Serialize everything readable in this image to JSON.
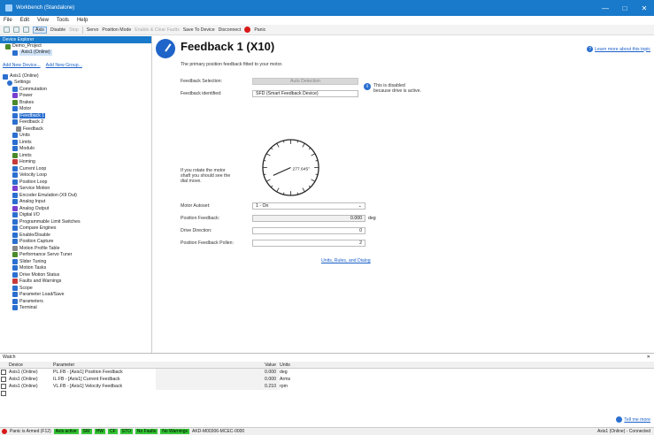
{
  "window": {
    "title": "Workbench (Standalone)",
    "controls": [
      "—",
      "□",
      "✕"
    ]
  },
  "menu": [
    "File",
    "Edit",
    "View",
    "Tools",
    "Help"
  ],
  "toolbar": {
    "axis_label": "Axis",
    "disable": "Disable",
    "stop": "Stop",
    "axis_sel": "Servo",
    "position_mode": "Position Mode",
    "enable_clear": "Enable & Clear Faults",
    "save_to_device": "Save To Device",
    "disconnect": "Disconnect",
    "panic": "Panic"
  },
  "sidebar": {
    "header": "Device Explorer",
    "project": "Demo_Project",
    "axis_online": "Axis1 (Online)",
    "links": [
      "Add New Device...",
      "Add New Group..."
    ],
    "tree_root": "Axis1 (Online)",
    "settings": "Settings",
    "items": [
      {
        "label": "Commutation",
        "color": "#2b6fcf"
      },
      {
        "label": "Power",
        "color": "#7b3fd0"
      },
      {
        "label": "Brakes",
        "color": "#4a8a2a"
      },
      {
        "label": "Motor",
        "color": "#2b6fcf"
      },
      {
        "label": "Feedback 1",
        "color": "#2b6fcf",
        "selected": true
      },
      {
        "label": "Feedback 2",
        "color": "#2b6fcf"
      },
      {
        "label": "Feedback",
        "color": "#888888"
      },
      {
        "label": "Units",
        "color": "#2b6fcf"
      },
      {
        "label": "Limits",
        "color": "#2b6fcf"
      },
      {
        "label": "Modulo",
        "color": "#2b6fcf"
      },
      {
        "label": "Limits",
        "color": "#4a8a2a"
      },
      {
        "label": "Homing",
        "color": "#c83a3a"
      },
      {
        "label": "Current Loop",
        "color": "#2b6fcf"
      },
      {
        "label": "Velocity Loop",
        "color": "#2b6fcf"
      },
      {
        "label": "Position Loop",
        "color": "#2b6fcf"
      },
      {
        "label": "Service Motion",
        "color": "#7b3fd0"
      },
      {
        "label": "Encoder Emulation (X9 Out)",
        "color": "#2b6fcf"
      },
      {
        "label": "Analog Input",
        "color": "#2b6fcf"
      },
      {
        "label": "Analog Output",
        "color": "#7b3fd0"
      },
      {
        "label": "Digital I/O",
        "color": "#2b6fcf"
      },
      {
        "label": "Programmable Limit Switches",
        "color": "#2b6fcf"
      },
      {
        "label": "Compare Engines",
        "color": "#2b6fcf"
      },
      {
        "label": "Enable/Disable",
        "color": "#2b6fcf"
      },
      {
        "label": "Position Capture",
        "color": "#2b6fcf"
      },
      {
        "label": "Motion Profile Table",
        "color": "#888888"
      },
      {
        "label": "Performance Servo Tuner",
        "color": "#4a8a2a"
      },
      {
        "label": "Slider Tuning",
        "color": "#2b6fcf"
      },
      {
        "label": "Motion Tasks",
        "color": "#2b6fcf"
      },
      {
        "label": "Drive Motion Status",
        "color": "#2b6fcf"
      },
      {
        "label": "Faults and Warnings",
        "color": "#c83a3a"
      },
      {
        "label": "Scope",
        "color": "#2b6fcf"
      },
      {
        "label": "Parameter Load/Save",
        "color": "#2b6fcf"
      },
      {
        "label": "Parameters",
        "color": "#2b6fcf"
      },
      {
        "label": "Terminal",
        "color": "#2b6fcf"
      }
    ]
  },
  "main": {
    "title": "Feedback 1 (X10)",
    "subtitle": "The primary position feedback fitted to your motor.",
    "learn_more": "Learn more about this topic",
    "fields": [
      {
        "label": "Feedback Selection:",
        "value": "Auto Detection",
        "disabled": true
      },
      {
        "label": "Feedback identified:",
        "value": "SFD (Smart Feedback Device)",
        "disabled": false
      }
    ],
    "info_note": "This is disabled because drive is active.",
    "dial_hint": "If you rotate the motor shaft you should see the dial move.",
    "dial_value": "277.645°",
    "fields2": [
      {
        "label": "Motor Autoset:",
        "value": "1 - On",
        "select": true
      },
      {
        "label": "Position Feedback:",
        "value": "0.000",
        "unit": "deg"
      },
      {
        "label": "Drive Direction:",
        "value": "0"
      },
      {
        "label": "Position Feedback Pollen:",
        "value": "2"
      }
    ],
    "gains_link": "Units, Rules, and Dialog"
  },
  "watch": {
    "title": "Watch",
    "close": "✕",
    "headers": [
      "",
      "Device",
      "Parameter",
      "Value",
      "Units"
    ],
    "rows": [
      {
        "device": "Axis1 (Online)",
        "param": "PL.FB - [Axis1] Position Feedback",
        "value": "0.000",
        "unit": "deg"
      },
      {
        "device": "Axis1 (Online)",
        "param": "IL.FB - [Axis1] Current Feedback",
        "value": "0.000",
        "unit": "Arms"
      },
      {
        "device": "Axis1 (Online)",
        "param": "VL.FB - [Axis1] Velocity Feedback",
        "value": "0.210",
        "unit": "rpm"
      }
    ],
    "tell_more": "Tell me more"
  },
  "status": {
    "panic": "Panic is Armed (F12)",
    "chips": [
      "Axis active",
      "SW",
      "HW",
      "CF",
      "STO",
      "No Faults",
      "No Warnings"
    ],
    "model": "AKD-M00306-MCEC-0000",
    "connection": "Axis1 (Online) - Connected"
  }
}
